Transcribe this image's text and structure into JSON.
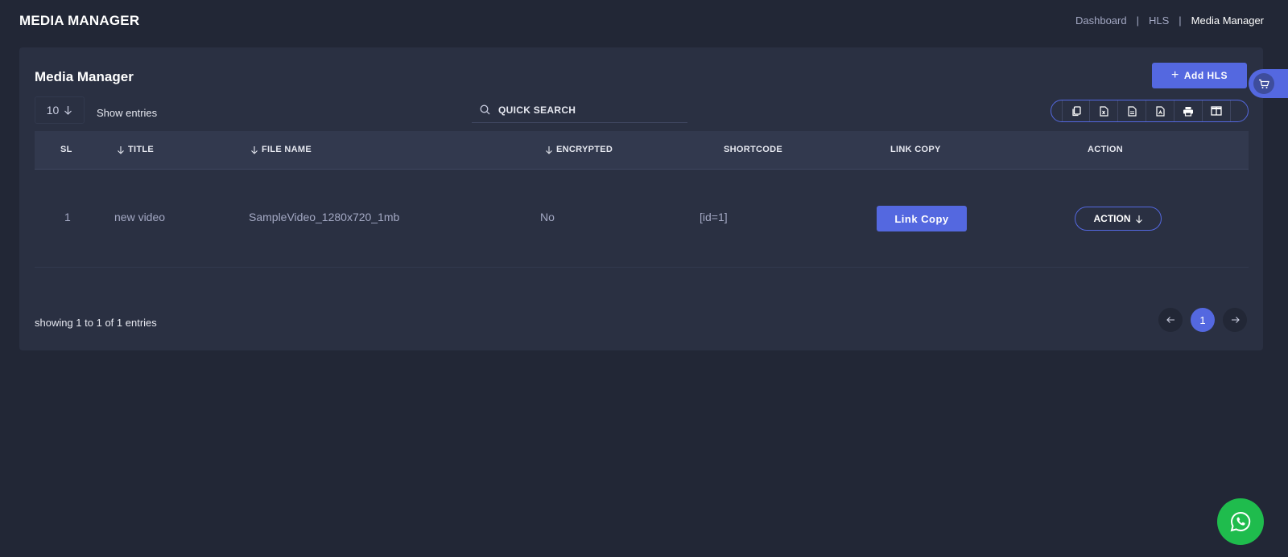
{
  "header": {
    "title": "MEDIA MANAGER",
    "breadcrumb": [
      "Dashboard",
      "HLS",
      "Media Manager"
    ]
  },
  "card": {
    "title": "Media Manager",
    "add_button": "Add HLS",
    "length_value": "10",
    "show_entries": "Show entries",
    "search_placeholder": "QUICK SEARCH",
    "export_icons": [
      "copy-icon",
      "excel-icon",
      "csv-icon",
      "pdf-icon",
      "print-icon",
      "columns-icon"
    ]
  },
  "table": {
    "headers": {
      "sl": "SL",
      "title": "TITLE",
      "file_name": "FILE NAME",
      "encrypted": "ENCRYPTED",
      "shortcode": "SHORTCODE",
      "link_copy": "LINK COPY",
      "action": "ACTION"
    },
    "rows": [
      {
        "sl": "1",
        "title": "new video",
        "file_name": "SampleVideo_1280x720_1mb",
        "encrypted": "No",
        "shortcode": "[id=1]",
        "link_copy": "Link Copy",
        "action": "ACTION"
      }
    ]
  },
  "footer": {
    "showing": "showing 1 to 1 of 1 entries",
    "current_page": "1"
  },
  "colors": {
    "accent": "#5468e0",
    "background": "#222736",
    "card": "#2a3042",
    "whatsapp": "#1fbc4d"
  }
}
